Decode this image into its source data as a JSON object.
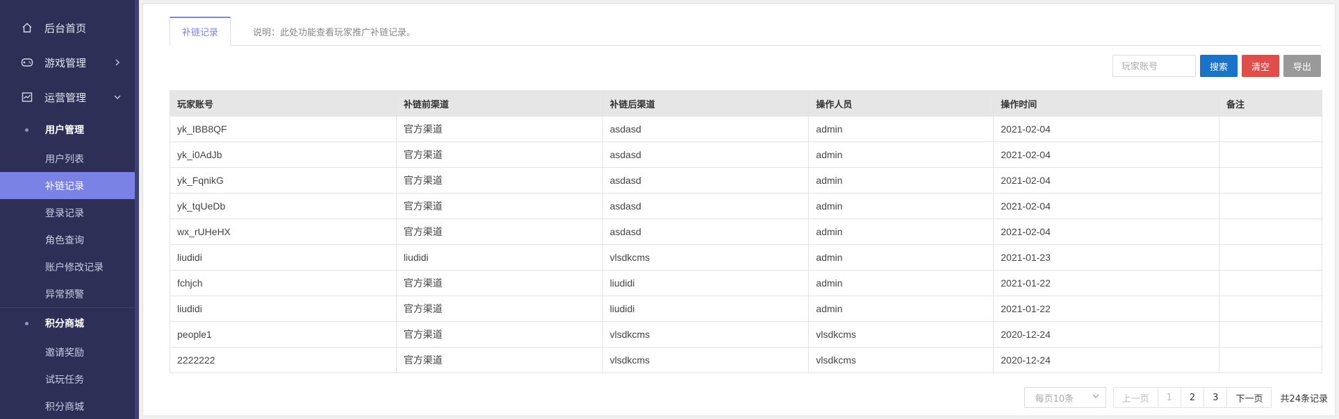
{
  "sidebar": {
    "home": "后台首页",
    "game_mgmt": "游戏管理",
    "ops_mgmt": "运营管理",
    "user_mgmt": {
      "title": "用户管理",
      "items": [
        "用户列表",
        "补链记录",
        "登录记录",
        "角色查询",
        "账户修改记录",
        "异常预警"
      ]
    },
    "points_mall": {
      "title": "积分商城",
      "items": [
        "邀请奖励",
        "试玩任务",
        "积分商城"
      ]
    }
  },
  "tabs": {
    "active": "补链记录",
    "description": "说明：此处功能查看玩家推广补链记录。"
  },
  "toolbar": {
    "search_placeholder": "玩家账号",
    "search": "搜索",
    "clear": "清空",
    "export": "导出"
  },
  "table": {
    "headers": [
      "玩家账号",
      "补链前渠道",
      "补链后渠道",
      "操作人员",
      "操作时间",
      "备注"
    ],
    "rows": [
      [
        "yk_IBB8QF",
        "官方渠道",
        "asdasd",
        "admin",
        "2021-02-04",
        ""
      ],
      [
        "yk_i0AdJb",
        "官方渠道",
        "asdasd",
        "admin",
        "2021-02-04",
        ""
      ],
      [
        "yk_FqnikG",
        "官方渠道",
        "asdasd",
        "admin",
        "2021-02-04",
        ""
      ],
      [
        "yk_tqUeDb",
        "官方渠道",
        "asdasd",
        "admin",
        "2021-02-04",
        ""
      ],
      [
        "wx_rUHeHX",
        "官方渠道",
        "asdasd",
        "admin",
        "2021-02-04",
        ""
      ],
      [
        "liudidi",
        "liudidi",
        "vlsdkcms",
        "admin",
        "2021-01-23",
        ""
      ],
      [
        "fchjch",
        "官方渠道",
        "liudidi",
        "admin",
        "2021-01-22",
        ""
      ],
      [
        "liudidi",
        "官方渠道",
        "liudidi",
        "admin",
        "2021-01-22",
        ""
      ],
      [
        "people1",
        "官方渠道",
        "vlsdkcms",
        "vlsdkcms",
        "2020-12-24",
        ""
      ],
      [
        "2222222",
        "官方渠道",
        "vlsdkcms",
        "vlsdkcms",
        "2020-12-24",
        ""
      ]
    ]
  },
  "pager": {
    "page_size": "每页10条",
    "prev": "上一页",
    "pages": [
      "1",
      "2",
      "3"
    ],
    "next": "下一页",
    "total": "共24条记录"
  },
  "colors": {
    "sidebar_bg": "#2d2f57",
    "accent": "#7b82e6",
    "search_btn": "#1a73c8",
    "clear_btn": "#e04d4a",
    "export_btn": "#999999"
  }
}
